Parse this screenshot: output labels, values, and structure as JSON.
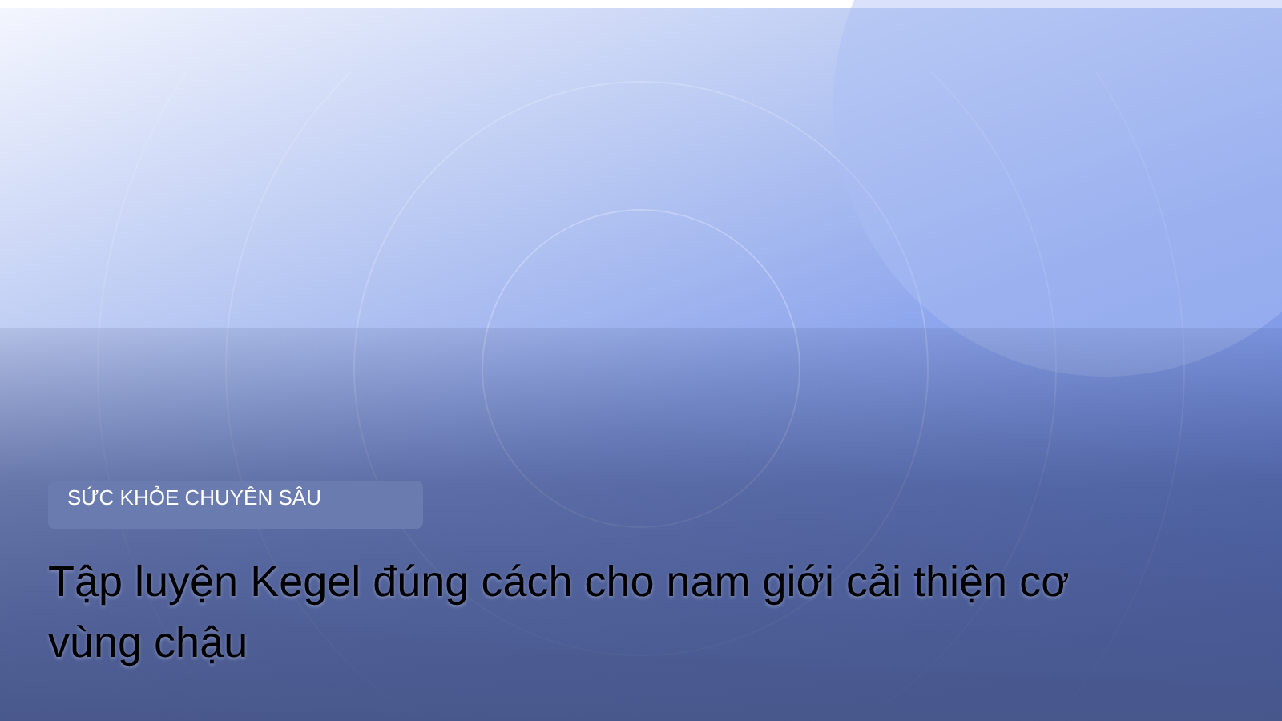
{
  "hero": {
    "category": "SỨC KHỎE CHUYÊN SÂU",
    "title": "Tập luyện Kegel đúng cách cho nam giới cải thiện cơ vùng chậu"
  }
}
